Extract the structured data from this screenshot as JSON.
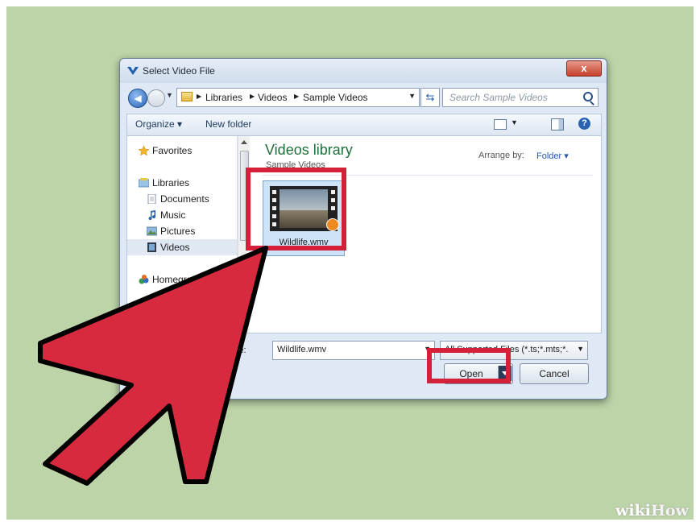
{
  "dialog": {
    "title": "Select Video File",
    "close_label": "x"
  },
  "address_bar": {
    "crumbs": [
      "Libraries",
      "Videos",
      "Sample Videos"
    ],
    "search_placeholder": "Search Sample Videos"
  },
  "toolbar": {
    "organize": "Organize ▾",
    "new_folder": "New folder",
    "help": "?"
  },
  "nav": {
    "favorites": "Favorites",
    "libraries": "Libraries",
    "documents": "Documents",
    "music": "Music",
    "pictures": "Pictures",
    "videos": "Videos",
    "homegroup": "Homegroup"
  },
  "library": {
    "title": "Videos library",
    "subtitle": "Sample Videos",
    "arrange_label": "Arrange by:",
    "arrange_value": "Folder ▾"
  },
  "files": [
    {
      "name": "Wildlife.wmv",
      "selected": true
    }
  ],
  "footer": {
    "filename_label": "name:",
    "filename_value": "Wildlife.wmv",
    "filetype_value": "All Supported Files (*.ts;*.mts;*.",
    "open_label": "Open",
    "cancel_label": "Cancel"
  },
  "watermark": {
    "wiki": "wiki",
    "how": "How"
  },
  "colors": {
    "background": "#bdd4a8",
    "highlight": "#d5203a",
    "arrow": "#d72a3e"
  }
}
